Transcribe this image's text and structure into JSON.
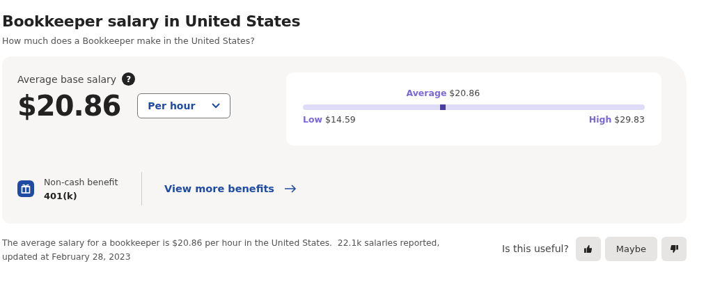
{
  "title": "Bookkeeper salary in United States",
  "subtitle": "How much does a Bookkeeper make in the United States?",
  "salary": {
    "label": "Average base salary",
    "help_icon": "?",
    "amount": "$20.86",
    "period": "Per hour"
  },
  "range": {
    "average_label": "Average",
    "average_value": "$20.86",
    "level": 0.41,
    "low_label": "Low",
    "low_value": "$14.59",
    "high_label": "High",
    "high_value": "$29.83"
  },
  "benefit": {
    "label": "Non-cash benefit",
    "value": "401(k)",
    "link": "View more benefits"
  },
  "footer": {
    "summary": "The average salary for a bookkeeper is $20.86 per hour in the United States.  22.1k salaries reported, updated at February 28, 2023",
    "question": "Is this useful?",
    "maybe": "Maybe"
  }
}
